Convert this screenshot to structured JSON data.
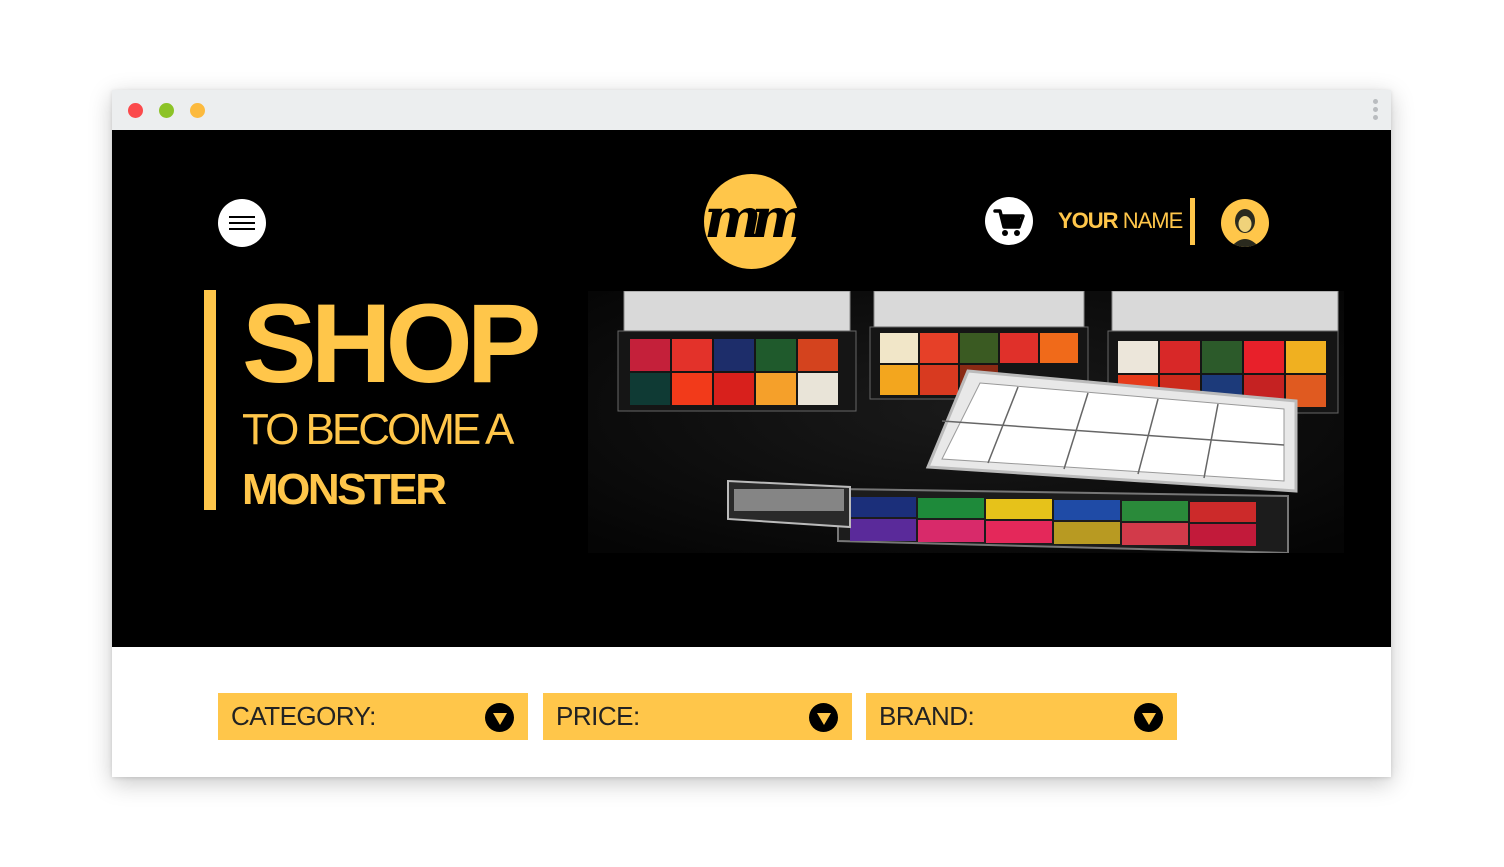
{
  "colors": {
    "accent": "#ffc64a",
    "hero_bg": "#000000",
    "dot_red": "#fb4a4c",
    "dot_green": "#8cc327",
    "dot_yellow": "#fcba3e"
  },
  "header": {
    "menu_icon": "hamburger-icon",
    "logo_text": "mm",
    "cart_icon": "cart-icon",
    "user": {
      "name_bold": "YOUR",
      "name_light": "NAME"
    }
  },
  "hero": {
    "title": "SHOP",
    "subtitle": "TO BECOME A",
    "emphasis": "MONSTER"
  },
  "filters": [
    {
      "label": "CATEGORY:",
      "icon": "dropdown-arrow-icon"
    },
    {
      "label": "PRICE:",
      "icon": "dropdown-arrow-icon"
    },
    {
      "label": "BRAND:",
      "icon": "dropdown-arrow-icon"
    }
  ]
}
